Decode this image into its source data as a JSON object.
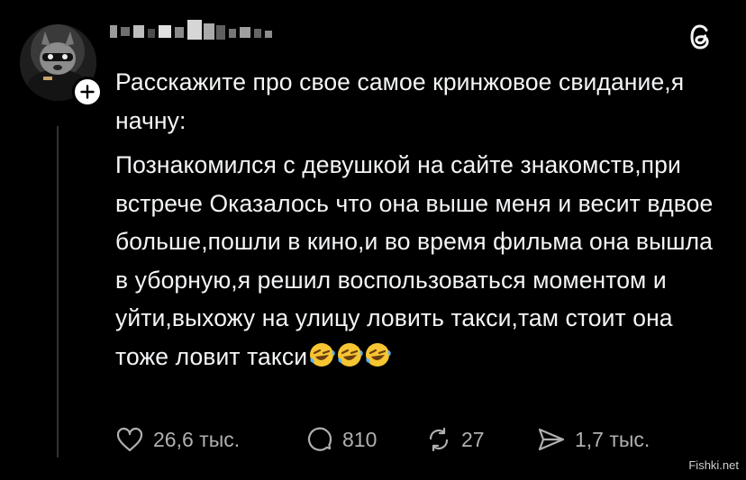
{
  "post": {
    "title_line": "Расскажите про свое самое кринжовое свидание,я начну:",
    "body": "Познакомился с девушкой на сайте знакомств,при встрече Оказалось что она выше меня и весит вдвое больше,пошли в кино,и во время фильма она вышла в уборную,я решил воспользоваться моментом и уйти,выхожу на улицу ловить такси,там стоит она тоже ловит такси",
    "emoji_icon": "rolling-on-floor-laughing-icon"
  },
  "actions": {
    "likes": "26,6 тыс.",
    "comments": "810",
    "reposts": "27",
    "shares": "1,7 тыс."
  },
  "icons": {
    "like": "heart-icon",
    "comment": "comment-icon",
    "repost": "repost-icon",
    "share": "share-icon",
    "logo": "threads-logo-icon",
    "follow": "plus-icon"
  },
  "watermark": "Fishki.net",
  "colors": {
    "background": "#000000",
    "text": "#f3f5f7",
    "muted": "#b0b0b0"
  }
}
